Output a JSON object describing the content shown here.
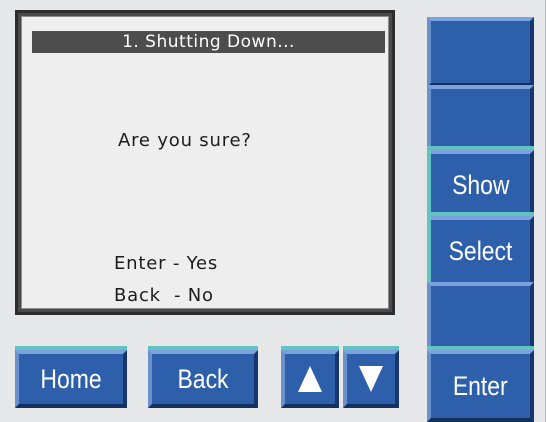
{
  "screen": {
    "title": "1. Shutting Down...",
    "prompt": "Are you sure?",
    "options": [
      {
        "text": "Enter - Yes"
      },
      {
        "text": "Back  - No"
      }
    ]
  },
  "side_keys": [
    {
      "label": ""
    },
    {
      "label": ""
    },
    {
      "label": "Show"
    },
    {
      "label": "Select"
    },
    {
      "label": ""
    },
    {
      "label": "Enter"
    }
  ],
  "bottom_keys": {
    "home": "Home",
    "back": "Back",
    "up_icon": "up-arrow-icon",
    "down_icon": "down-arrow-icon"
  },
  "colors": {
    "key_blue": "#2d5fab",
    "teal_accent": "#63c3c3",
    "panel_gray": "#e6e7e8",
    "lcd_background": "#eeeeef",
    "title_bar": "#4d4d4d"
  }
}
